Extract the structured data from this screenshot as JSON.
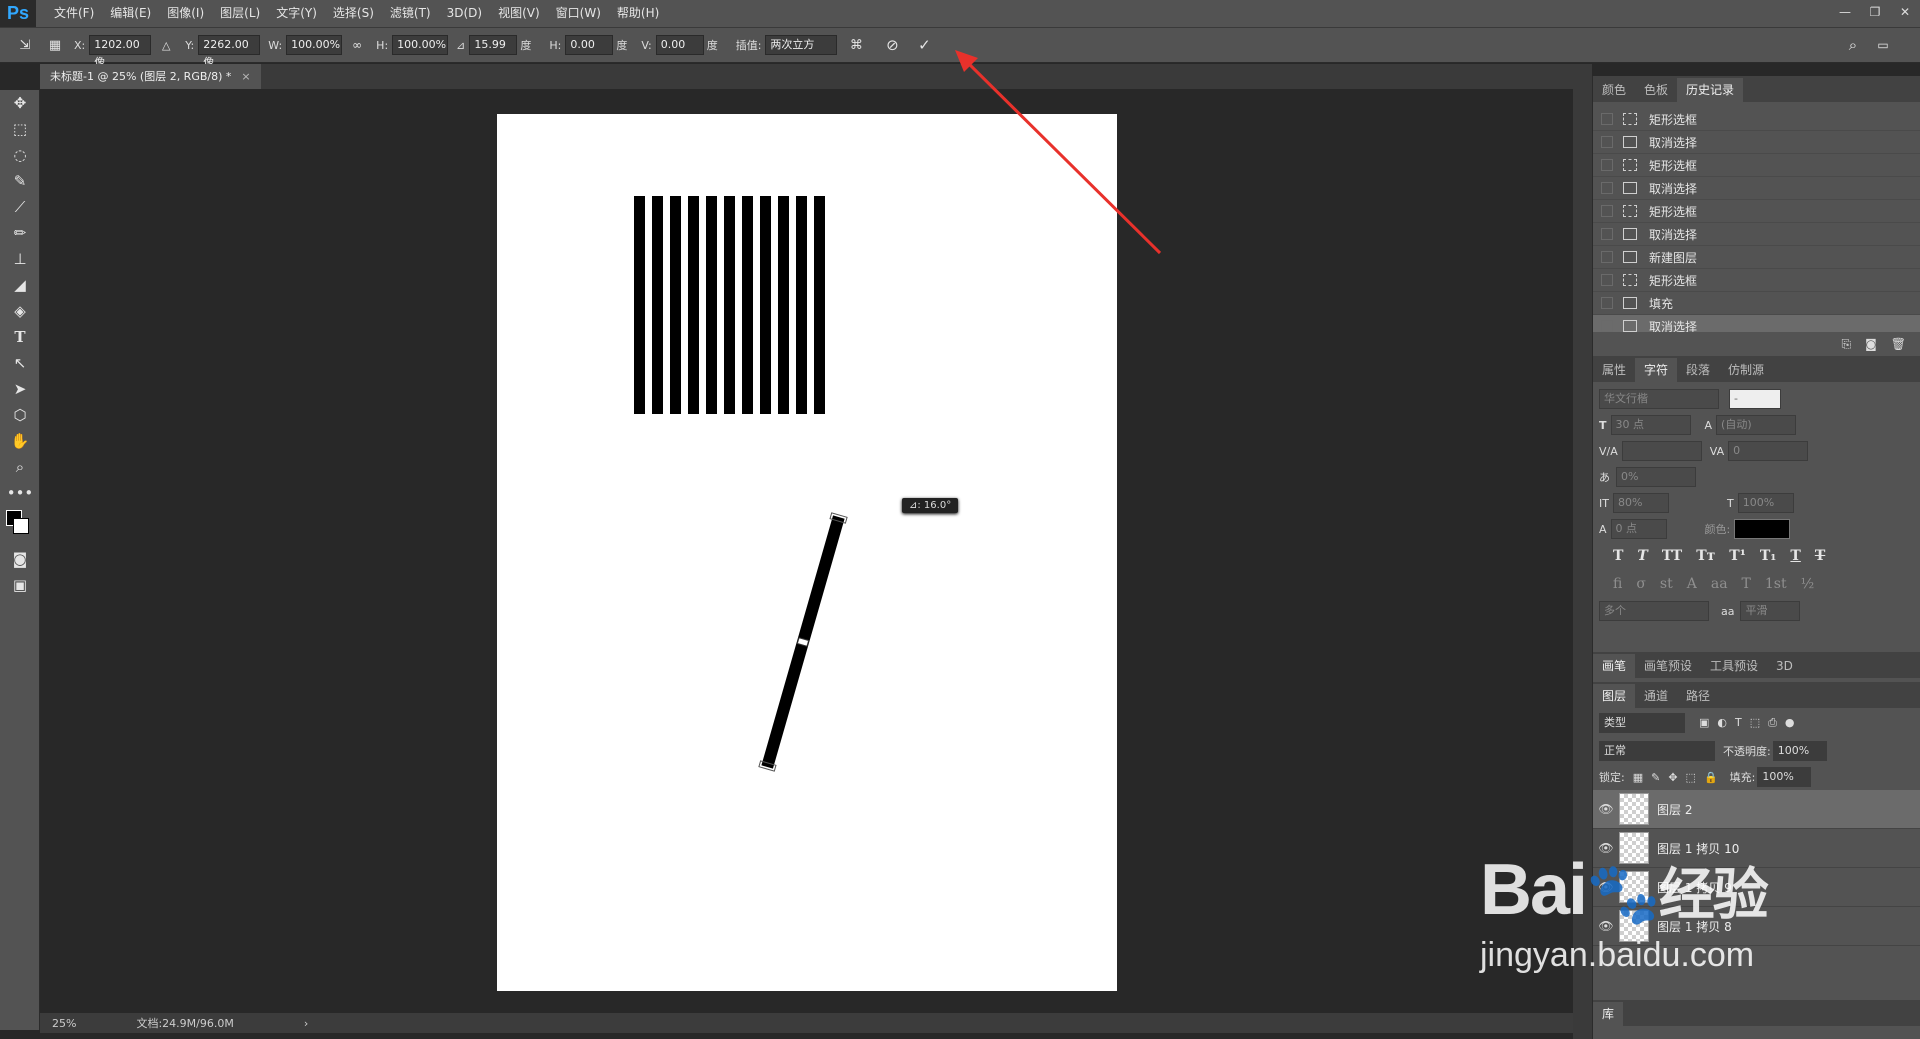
{
  "app": {
    "logo": "Ps"
  },
  "menu": [
    "文件(F)",
    "编辑(E)",
    "图像(I)",
    "图层(L)",
    "文字(Y)",
    "选择(S)",
    "滤镜(T)",
    "3D(D)",
    "视图(V)",
    "窗口(W)",
    "帮助(H)"
  ],
  "options": {
    "x_label": "X:",
    "x_value": "1202.00 像",
    "y_label": "Y:",
    "y_value": "2262.00 像",
    "w_label": "W:",
    "w_value": "100.00%",
    "h_label": "H:",
    "h_value": "100.00%",
    "angle_value": "15.99",
    "angle_unit": "度",
    "hskew_label": "H:",
    "hskew_value": "0.00",
    "hskew_unit": "度",
    "vskew_label": "V:",
    "vskew_value": "0.00",
    "vskew_unit": "度",
    "interp_label": "插值:",
    "interp_value": "两次立方"
  },
  "document_tab": {
    "title": "未标题-1 @ 25% (图层 2, RGB/8) *",
    "close": "×"
  },
  "rotate_tooltip": "⊿: 16.0°",
  "status": {
    "zoom": "25%",
    "doc_info": "文档:24.9M/96.0M",
    "more": "›"
  },
  "history_panel": {
    "tabs": [
      "颜色",
      "色板",
      "历史记录"
    ],
    "items": [
      {
        "label": "矩形选框",
        "type": "marquee"
      },
      {
        "label": "取消选择",
        "type": "doc"
      },
      {
        "label": "矩形选框",
        "type": "marquee"
      },
      {
        "label": "取消选择",
        "type": "doc"
      },
      {
        "label": "矩形选框",
        "type": "marquee"
      },
      {
        "label": "取消选择",
        "type": "doc"
      },
      {
        "label": "新建图层",
        "type": "doc"
      },
      {
        "label": "矩形选框",
        "type": "marquee"
      },
      {
        "label": "填充",
        "type": "doc"
      },
      {
        "label": "取消选择",
        "type": "doc"
      }
    ]
  },
  "character_panel": {
    "tabs": [
      "属性",
      "字符",
      "段落",
      "仿制源"
    ],
    "font_family": "华文行楷",
    "font_style": "-",
    "size": "30 点",
    "leading": "(自动)",
    "tracking": "0",
    "vscale_label": "0%",
    "v_scale": "80%",
    "h_scale": "100%",
    "baseline": "0 点",
    "color_label": "颜色:",
    "language": "多个",
    "aa": "平滑",
    "aa_label": "aa"
  },
  "brush_tabs": [
    "画笔",
    "画笔预设",
    "工具预设",
    "3D"
  ],
  "layers_panel": {
    "tabs": [
      "图层",
      "通道",
      "路径"
    ],
    "filter": "类型",
    "blend_mode": "正常",
    "opacity_label": "不透明度:",
    "opacity": "100%",
    "lock_label": "锁定:",
    "fill_label": "填充:",
    "fill": "100%",
    "layers": [
      {
        "name": "图层 2",
        "selected": true
      },
      {
        "name": "图层 1 拷贝 10",
        "selected": false
      },
      {
        "name": "图层 1 拷贝 9",
        "selected": false
      },
      {
        "name": "图层 1 拷贝 8",
        "selected": false
      }
    ]
  },
  "library_tab": "库",
  "watermark": {
    "brand": "Bai",
    "brand2": "经验",
    "url": "jingyan.baidu.com"
  },
  "accent": "#e8312b"
}
